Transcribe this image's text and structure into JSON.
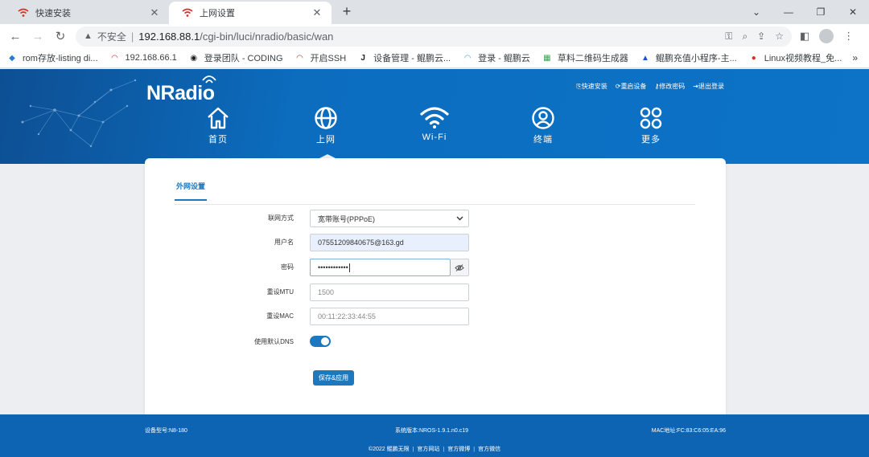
{
  "browser": {
    "tabs": [
      {
        "title": "快速安装",
        "active": false
      },
      {
        "title": "上网设置",
        "active": true
      }
    ],
    "url": {
      "insecure_label": "不安全",
      "separator": "|",
      "host": "192.168.88.1",
      "path": "/cgi-bin/luci/nradio/basic/wan"
    },
    "bookmarks": [
      {
        "label": "rom存放-listing di...",
        "icon": "diamond-icon",
        "color": "#2a7bd3"
      },
      {
        "label": "192.168.66.1",
        "icon": "wifi-icon",
        "color": "#d93025"
      },
      {
        "label": "登录团队 - CODING",
        "icon": "coding-icon",
        "color": "#202124"
      },
      {
        "label": "开启SSH",
        "icon": "wifi-icon",
        "color": "#d93025"
      },
      {
        "label": "设备管理 - 鲲鹏云...",
        "icon": "j-icon",
        "color": "#202124"
      },
      {
        "label": "登录 - 鲲鹏云",
        "icon": "wifi-icon",
        "color": "#4aa8e8"
      },
      {
        "label": "草料二维码生成器",
        "icon": "qr-icon",
        "color": "#34a853"
      },
      {
        "label": "鲲鹏充值小程序-主...",
        "icon": "triangle-icon",
        "color": "#1a56c9"
      },
      {
        "label": "Linux视频教程_免...",
        "icon": "ifp-icon",
        "color": "#d93025"
      }
    ],
    "bookmarks_more": "»"
  },
  "header": {
    "logo": "NRadio",
    "top_links": [
      "快速安装",
      "重启设备",
      "修改密码",
      "退出登录"
    ],
    "nav": [
      {
        "label": "首页",
        "icon": "home-icon"
      },
      {
        "label": "上网",
        "icon": "globe-icon",
        "active": true
      },
      {
        "label": "Wi-Fi",
        "icon": "wifi-icon"
      },
      {
        "label": "终端",
        "icon": "user-icon"
      },
      {
        "label": "更多",
        "icon": "more-icon"
      }
    ],
    "colors": {
      "primary": "#0c6dbf",
      "dark": "#0d4f93"
    }
  },
  "page": {
    "tab": "外网设置",
    "form": {
      "mode": {
        "label": "联网方式",
        "value": "宽带账号(PPPoE)"
      },
      "username": {
        "label": "用户名",
        "value": "07551209840675@163.gd"
      },
      "password": {
        "label": "密码",
        "value": "••••••••••••"
      },
      "mtu": {
        "label": "重设MTU",
        "value": "1500"
      },
      "mac": {
        "label": "重设MAC",
        "value": "00:11:22:33:44:55"
      },
      "dns": {
        "label": "使用默认DNS",
        "enabled": true
      }
    },
    "save_label": "保存&应用",
    "accent": "#1c79c0"
  },
  "footer": {
    "model": "设备型号:N8-180",
    "version": "系统版本:NROS-1.9.1.n0.c19",
    "mac": "MAC地址:FC:83:C6:05:EA:96",
    "copyright": "©2022 鲲鹏无限",
    "links": [
      "官方网站",
      "官方微博",
      "官方微信"
    ]
  }
}
